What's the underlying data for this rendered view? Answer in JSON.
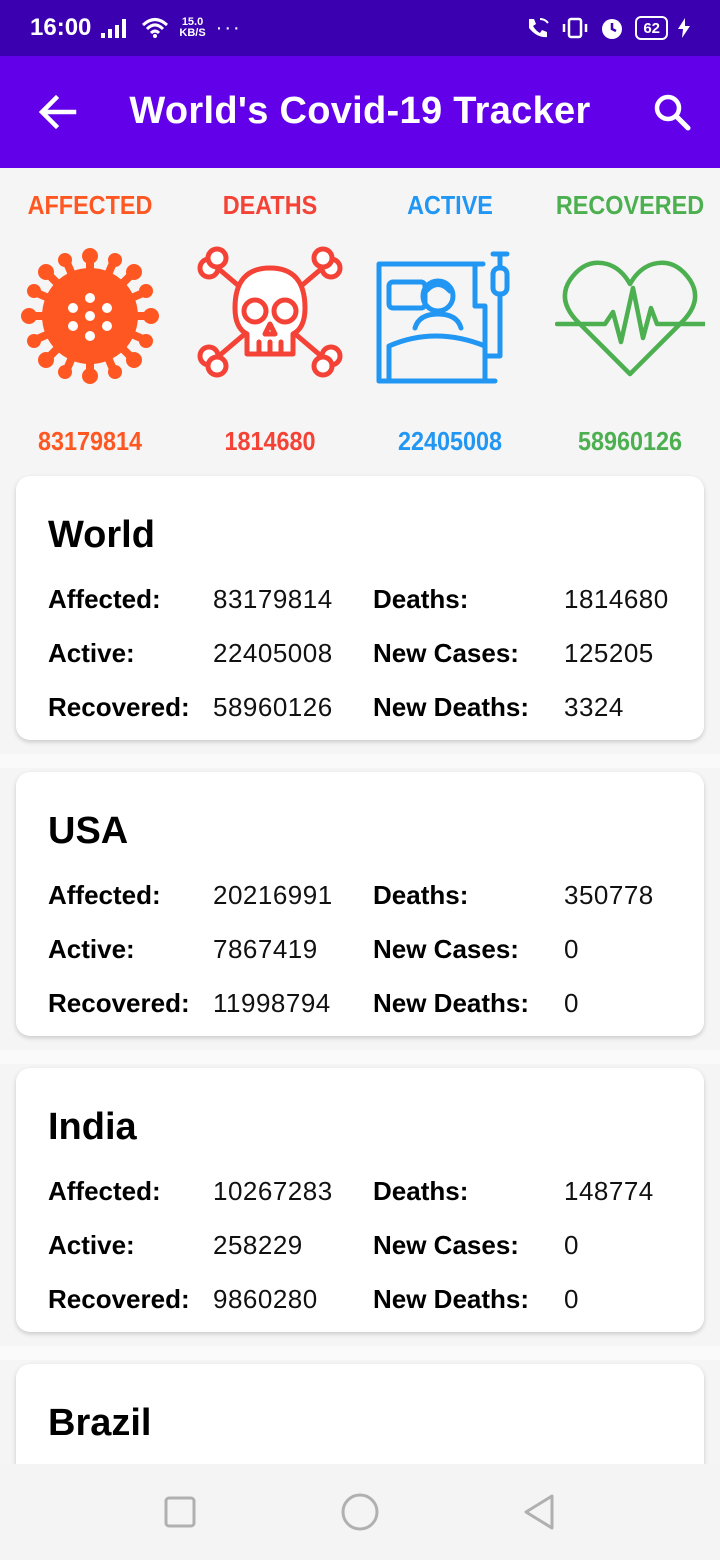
{
  "status_bar": {
    "time": "16:00",
    "speed_value": "15.0",
    "speed_unit": "KB/S",
    "dots": "···",
    "battery": "62"
  },
  "app_bar": {
    "title": "World's Covid-19 Tracker",
    "back_icon": "arrow-left-icon",
    "search_icon": "search-icon"
  },
  "summary": [
    {
      "label": "AFFECTED",
      "value": "83179814",
      "color": "#ff5722",
      "icon": "virus-icon"
    },
    {
      "label": "DEATHS",
      "value": "1814680",
      "color": "#f44336",
      "icon": "skull-crossbones-icon"
    },
    {
      "label": "ACTIVE",
      "value": "22405008",
      "color": "#2196f3",
      "icon": "patient-in-bed-icon"
    },
    {
      "label": "RECOVERED",
      "value": "58960126",
      "color": "#4caf50",
      "icon": "heartbeat-icon"
    }
  ],
  "labels": {
    "affected": "Affected:",
    "active": "Active:",
    "recovered": "Recovered:",
    "deaths": "Deaths:",
    "new_cases": "New Cases:",
    "new_deaths": "New Deaths:"
  },
  "countries": [
    {
      "name": "World",
      "affected": "83179814",
      "active": "22405008",
      "recovered": "58960126",
      "deaths": "1814680",
      "new_cases": "125205",
      "new_deaths": "3324"
    },
    {
      "name": "USA",
      "affected": "20216991",
      "active": "7867419",
      "recovered": "11998794",
      "deaths": "350778",
      "new_cases": "0",
      "new_deaths": "0"
    },
    {
      "name": "India",
      "affected": "10267283",
      "active": "258229",
      "recovered": "9860280",
      "deaths": "148774",
      "new_cases": "0",
      "new_deaths": "0"
    },
    {
      "name": "Brazil"
    }
  ],
  "nav_bar": {
    "recents_icon": "square-recents-icon",
    "home_icon": "circle-home-icon",
    "back_icon": "triangle-back-icon"
  }
}
